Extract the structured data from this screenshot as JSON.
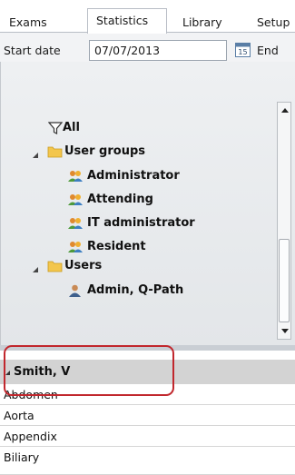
{
  "tabs": [
    {
      "label": "Exams",
      "active": false
    },
    {
      "label": "Statistics",
      "active": true
    },
    {
      "label": "Library",
      "active": false
    },
    {
      "label": "Setup",
      "active": false
    }
  ],
  "date_filter": {
    "start_label": "Start date",
    "start_value": "07/07/2013",
    "calendar_number": "15",
    "end_label": "End"
  },
  "tree": {
    "all_label": "All",
    "user_groups_label": "User groups",
    "groups": [
      "Administrator",
      "Attending",
      "IT administrator",
      "Resident"
    ],
    "users_label": "Users",
    "users": [
      "Admin, Q-Path"
    ]
  },
  "results": {
    "group_header": "Smith, V",
    "items": [
      "Abdomen",
      "Aorta",
      "Appendix",
      "Biliary"
    ]
  },
  "colors": {
    "highlight_border": "#c1272d",
    "folder": "#f3c64c",
    "group_header_bg": "#d3d3d3"
  }
}
